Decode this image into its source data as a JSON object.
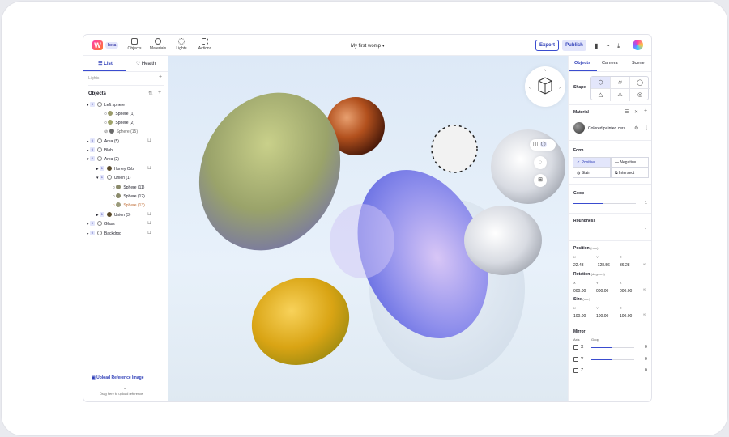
{
  "app": {
    "badge": "beta",
    "logo_letter": "W",
    "doc_title": "My first womp"
  },
  "toolbar": {
    "nav": [
      {
        "label": "Objects"
      },
      {
        "label": "Materials"
      },
      {
        "label": "Lights"
      },
      {
        "label": "Actions"
      }
    ],
    "export_label": "Export",
    "publish_label": "Publish"
  },
  "left": {
    "tabs": [
      {
        "label": "List"
      },
      {
        "label": "Health"
      }
    ],
    "lights_label": "Lights",
    "objects_label": "Objects",
    "tree": [
      {
        "num": "0",
        "name": "Left sphere"
      },
      {
        "name": "Sphere (1)"
      },
      {
        "name": "Sphere (2)"
      },
      {
        "name": "Sphere (15)"
      },
      {
        "num": "0",
        "name": "Area (5)"
      },
      {
        "num": "0",
        "name": "Blob"
      },
      {
        "num": "0",
        "name": "Area (2)"
      },
      {
        "num": "1",
        "name": "Honey Orb"
      },
      {
        "num": "1",
        "name": "Union (1)"
      },
      {
        "name": "Sphere (11)"
      },
      {
        "name": "Sphere (12)"
      },
      {
        "name": "Sphere (13)"
      },
      {
        "num": "1",
        "name": "Union (3)"
      },
      {
        "num": "0",
        "name": "Glass"
      },
      {
        "num": "0",
        "name": "Backdrop"
      }
    ],
    "upload_label": "Upload Reference Image",
    "or_label": "or",
    "drag_label": "Drag here to upload reference"
  },
  "right": {
    "tabs": [
      {
        "label": "Objects"
      },
      {
        "label": "Camera"
      },
      {
        "label": "Scene"
      }
    ],
    "shape_label": "Shape",
    "material_label": "Material",
    "material_name": "Colored painted cera...",
    "form_label": "Form",
    "form_options": [
      {
        "label": "Positive"
      },
      {
        "label": "Negative"
      },
      {
        "label": "Stain"
      },
      {
        "label": "Intersect"
      }
    ],
    "goop_label": "Goop",
    "goop_value": "1",
    "roundness_label": "Roundness",
    "roundness_value": "1",
    "position_label": "Position",
    "position_unit": "(mm)",
    "position": {
      "x": "22.43",
      "y": "-128.56",
      "z": "36.28"
    },
    "rotation_label": "Rotation",
    "rotation_unit": "(degrees)",
    "rotation": {
      "x": "000.00",
      "y": "000.00",
      "z": "000.00"
    },
    "size_label": "Size",
    "size_unit": "(mm)",
    "size": {
      "x": "100.00",
      "y": "100.00",
      "z": "100.00"
    },
    "axis_labels": {
      "x": "X",
      "y": "Y",
      "z": "Z"
    },
    "mirror_label": "Mirror",
    "mirror_axis_label": "Axis",
    "mirror_goop_label": "Goop",
    "mirror": [
      {
        "axis": "X",
        "value": "0"
      },
      {
        "axis": "Y",
        "value": "0"
      },
      {
        "axis": "Z",
        "value": "0"
      }
    ]
  },
  "colors": {
    "accent": "#3a4ccf",
    "accent_light": "#e3e6fb",
    "viewport_bg": "#e4eef9"
  }
}
